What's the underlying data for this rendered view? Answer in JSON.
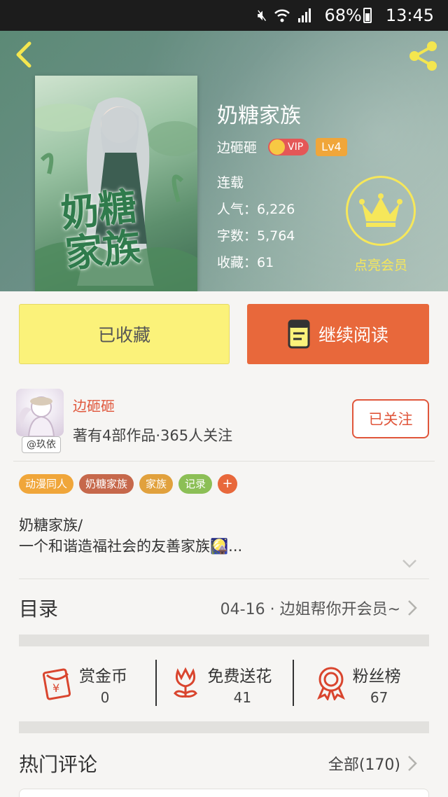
{
  "status_bar": {
    "battery": "68%",
    "time": "13:45"
  },
  "book": {
    "title": "奶糖家族",
    "cover_title": "奶糖家族",
    "author": "边砸砸",
    "vip_label": "VIP",
    "level": "Lv4",
    "status": "连载",
    "popularity": "人气：6,226",
    "word_count": "字数：5,764",
    "collections": "收藏：61"
  },
  "membership": {
    "label": "点亮会员"
  },
  "actions": {
    "collected_label": "已收藏",
    "continue_label": "继续阅读"
  },
  "author": {
    "avatar_tag": "@玖依",
    "name": "边砸砸",
    "stats": "著有4部作品·365人关注",
    "follow_label": "已关注"
  },
  "tags": [
    {
      "label": "动漫同人",
      "color": "#f0a63a"
    },
    {
      "label": "奶糖家族",
      "color": "#c6684b"
    },
    {
      "label": "家族",
      "color": "#e1a13d"
    },
    {
      "label": "记录",
      "color": "#8cbf56"
    }
  ],
  "tag_add_label": "+",
  "description": {
    "line1": "奶糖家族/",
    "line2": "一个和谐造福社会的友善家族🎑..."
  },
  "catalog": {
    "title": "目录",
    "latest": "04-16 · 边姐帮你开会员~"
  },
  "stats": [
    {
      "label": "赏金币",
      "value": "0",
      "icon": "red-envelope-icon"
    },
    {
      "label": "免费送花",
      "value": "41",
      "icon": "flower-icon"
    },
    {
      "label": "粉丝榜",
      "value": "67",
      "icon": "medal-icon"
    }
  ],
  "hot_comments": {
    "title": "热门评论",
    "all": "全部(170)"
  },
  "colors": {
    "accent_orange": "#e8683b",
    "accent_red": "#e0563b",
    "collected_yellow": "#fbf27a",
    "crown_yellow": "#f6e75a"
  }
}
